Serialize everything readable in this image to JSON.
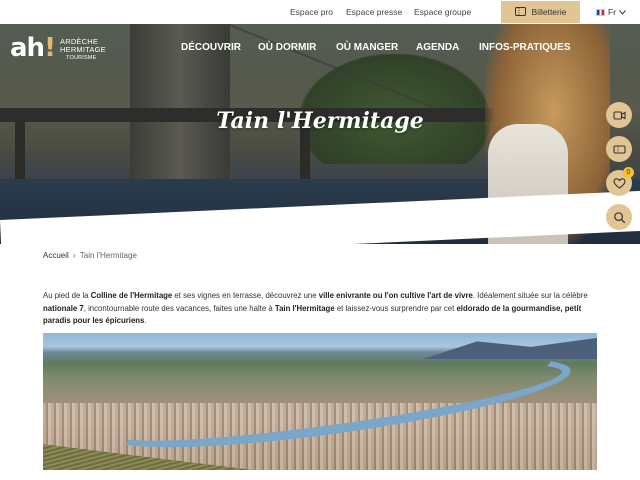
{
  "topbar": {
    "links": [
      "Espace pro",
      "Espace presse",
      "Espace groupe"
    ],
    "billetterie_label": "Billetterie",
    "lang_label": "Fr"
  },
  "logo": {
    "mark": "ah",
    "bang": "!",
    "line1": "ARDÈCHE",
    "line2": "HERMITAGE",
    "line3": "TOURISME"
  },
  "nav": {
    "items": [
      "DÉCOUVRIR",
      "OÙ DORMIR",
      "OÙ MANGER",
      "AGENDA",
      "INFOS-PRATIQUES"
    ]
  },
  "hero": {
    "title": "Tain l'Hermitage"
  },
  "fabs": {
    "badge_count": "0",
    "icons": [
      "video-call-icon",
      "ticket-icon",
      "heart-icon",
      "search-icon"
    ]
  },
  "breadcrumb": {
    "home": "Accueil",
    "separator": "›",
    "current": "Tain l'Hermitage"
  },
  "intro": {
    "p1": "Au pied de la ",
    "b1": "Colline de l'Hermitage",
    "p2": " et ses vignes en terrasse, découvrez une ",
    "b2": "ville enivrante ou l'on cultive l'art de vivre",
    "p3": ".  Idéalement située sur la célèbre ",
    "b3": "nationale 7",
    "p4": ", incontournable route des vacances, faites une halte à ",
    "b4": "Tain l'Hermitage",
    "p5": " et laissez-vous surprendre par cet ",
    "b5": "eldorado de la gourmandise, petit paradis pour les épicuriens",
    "p6": "."
  },
  "colors": {
    "accent_gold": "#e2c595",
    "badge_yellow": "#f3c12b",
    "logo_accent": "#e2b96e"
  }
}
